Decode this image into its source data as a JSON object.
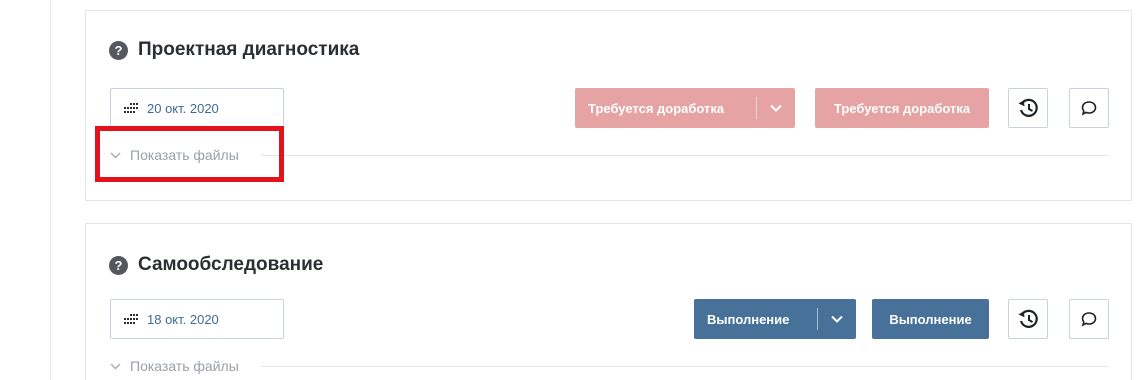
{
  "sections": [
    {
      "title": "Проектная диагностика",
      "date": "20 окт. 2020",
      "status_split_label": "Требуется доработка",
      "status_button_label": "Требуется доработка",
      "status_color": "#e5a3a3",
      "files_toggle_label": "Показать файлы",
      "highlighted": true
    },
    {
      "title": "Самообследование",
      "date": "18 окт. 2020",
      "status_split_label": "Выполнение",
      "status_button_label": "Выполнение",
      "status_color": "#477199",
      "files_toggle_label": "Показать файлы",
      "highlighted": false
    }
  ],
  "icons": {
    "help": "question-circle",
    "calendar": "calendar-grid",
    "dropdown": "chevron-down",
    "history": "history-clock",
    "comment": "speech-bubble",
    "files_toggle": "chevron-down"
  },
  "colors": {
    "highlight_box": "#e3121b",
    "date_text": "#3f6a95"
  }
}
